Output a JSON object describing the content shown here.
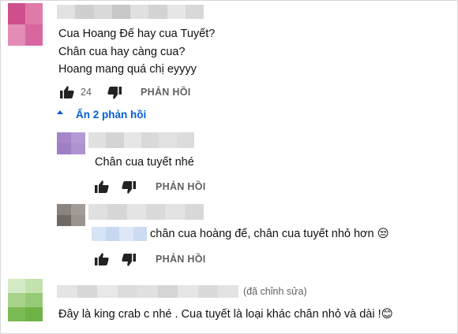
{
  "comments": [
    {
      "lines": [
        "Cua Hoang Đế hay cua Tuyết?",
        "Chân cua hay càng cua?",
        "Hoang mang quá chị eyyyy"
      ],
      "likes": "24",
      "reply_label": "PHẢN HỒI",
      "avatar_color": "#d96aa0",
      "replies_toggle": "Ẩn 2 phản hồi"
    }
  ],
  "replies": [
    {
      "text": "Chân cua tuyết nhé",
      "reply_label": "PHẢN HỒI",
      "avatar_color": "#a98ccc"
    },
    {
      "text": "chân cua hoàng đế, chân cua tuyết nhỏ hơn",
      "emoji": "😒",
      "reply_label": "PHẢN HỒI",
      "avatar_color": "#7d7570"
    }
  ],
  "last_comment": {
    "edited": "(đã chỉnh sửa)",
    "text": "Đây là king crab c nhé . Cua tuyết là loại khác chân nhỏ và dài !",
    "emoji": "😊",
    "avatar_color": "#8ec873"
  },
  "colors": {
    "link_blue": "#065fd4",
    "meta_gray": "#606060"
  }
}
